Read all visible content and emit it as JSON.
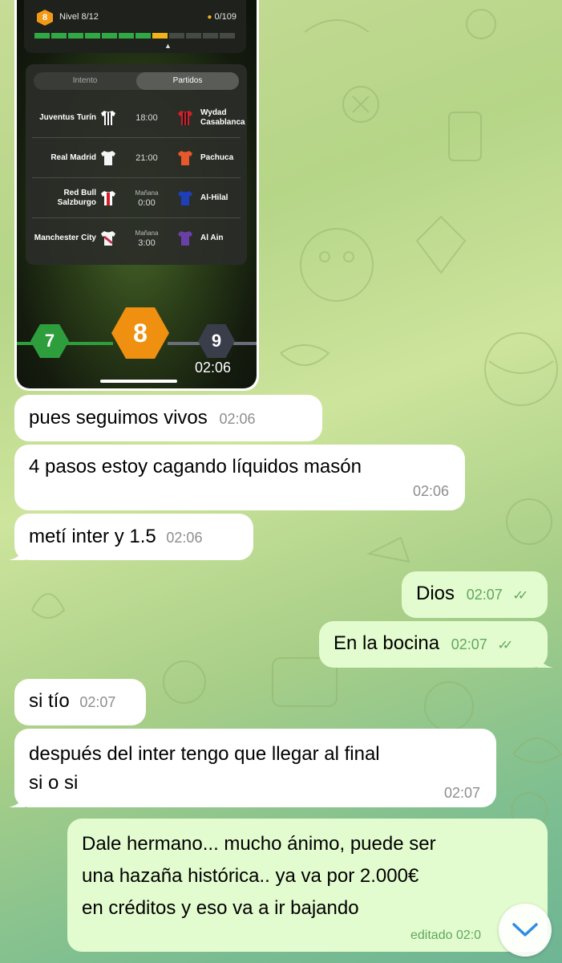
{
  "shared_screenshot": {
    "level_badge": "8",
    "level_text": "Nivel 8/12",
    "users_count": "0/109",
    "progress": {
      "total_segments": 12,
      "completed": 7,
      "current": 8
    },
    "tabs": [
      "Intento",
      "Partidos"
    ],
    "active_tab": "Partidos",
    "matches": [
      {
        "home": "Juventus Turín",
        "time_label": "",
        "time": "18:00",
        "away": "Wydad Casablanca"
      },
      {
        "home": "Real Madrid",
        "time_label": "",
        "time": "21:00",
        "away": "Pachuca"
      },
      {
        "home": "Red Bull Salzburgo",
        "time_label": "Mañana",
        "time": "0:00",
        "away": "Al-Hilal"
      },
      {
        "home": "Manchester City",
        "time_label": "Mañana",
        "time": "3:00",
        "away": "Al Ain"
      }
    ],
    "levels": [
      "7",
      "8",
      "9"
    ],
    "timestamp": "02:06"
  },
  "messages": [
    {
      "dir": "in",
      "text": "pues seguimos vivos",
      "time": "02:06"
    },
    {
      "dir": "in",
      "text": "4 pasos estoy cagando líquidos masón",
      "time": "02:06"
    },
    {
      "dir": "in",
      "text": "metí inter y 1.5",
      "time": "02:06"
    },
    {
      "dir": "out",
      "text": "Dios",
      "time": "02:07"
    },
    {
      "dir": "out",
      "text": "En la bocina",
      "time": "02:07"
    },
    {
      "dir": "in",
      "text": "si tío",
      "time": "02:07"
    },
    {
      "dir": "in",
      "text_line1": "después del inter tengo que llegar al final",
      "text_line2": "si o si",
      "time": "02:07"
    },
    {
      "dir": "out",
      "text_line1": "Dale hermano... mucho ánimo, puede ser",
      "text_line2": "una hazaña histórica.. ya va por 2.000€",
      "text_line3": "en créditos y eso va a ir bajando",
      "time": "editado 02:0"
    }
  ],
  "colors": {
    "incoming_bubble": "#ffffff",
    "outgoing_bubble": "#e3fccf",
    "read_ticks": "#5fa75d",
    "level_current": "#f09010",
    "level_done": "#2e9e3c"
  },
  "icons": {
    "users": "person-icon",
    "read_status": "double-check-icon",
    "scroll_down": "chevron-down-icon"
  }
}
